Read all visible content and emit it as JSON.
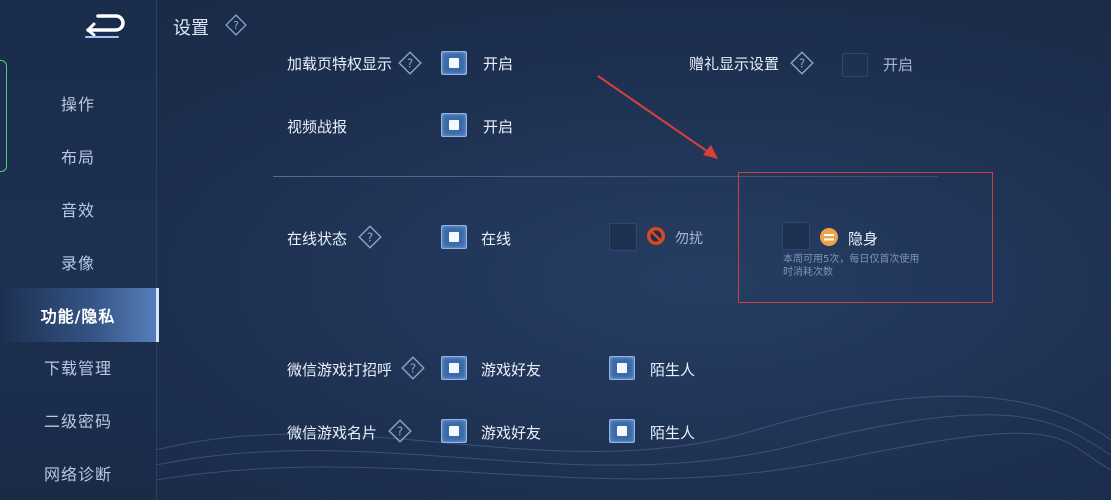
{
  "header": {
    "title": "设置"
  },
  "sidebar": {
    "items": [
      {
        "label": "操作"
      },
      {
        "label": "布局"
      },
      {
        "label": "音效"
      },
      {
        "label": "录像"
      },
      {
        "label": "功能/隐私",
        "active": true
      },
      {
        "label": "下载管理"
      },
      {
        "label": "二级密码"
      },
      {
        "label": "网络诊断"
      }
    ]
  },
  "settings": {
    "loading_privilege": {
      "label": "加载页特权显示",
      "option": "开启",
      "checked": true
    },
    "gift_display": {
      "label": "赠礼显示设置",
      "option": "开启",
      "checked": false
    },
    "video_report": {
      "label": "视频战报",
      "option": "开启",
      "checked": true
    },
    "online_status": {
      "label": "在线状态",
      "online": "在线",
      "dnd": "勿扰",
      "invisible": "隐身",
      "invisible_note": "本周可用5次，每日仅首次使用时消耗次数"
    },
    "wechat_greet": {
      "label": "微信游戏打招呼",
      "friends": "游戏好友",
      "strangers": "陌生人"
    },
    "wechat_card": {
      "label": "微信游戏名片",
      "friends": "游戏好友",
      "strangers": "陌生人"
    }
  },
  "colors": {
    "accent": "#3a6aa8",
    "annotation": "#d9403a",
    "dnd_icon": "#d9481f",
    "invisible_icon": "#f0a24a"
  }
}
